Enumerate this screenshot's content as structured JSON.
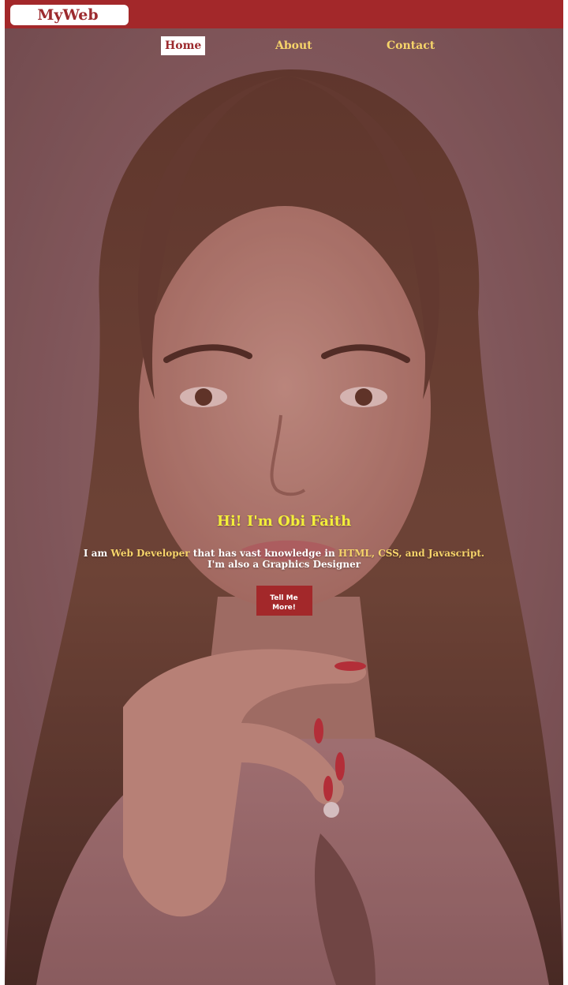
{
  "brand": {
    "name": "MyWeb"
  },
  "nav": {
    "items": [
      {
        "label": "Home",
        "active": true
      },
      {
        "label": "About",
        "active": false
      },
      {
        "label": "Contact",
        "active": false
      }
    ]
  },
  "hero": {
    "greeting": "Hi! I'm Obi Faith",
    "intro_prefix": "I am ",
    "role": "Web Developer",
    "intro_middle": " that has vast knowledge in ",
    "skills": "HTML, CSS, and Javascript.",
    "intro_line2": "I'm also a Graphics Designer",
    "cta_label": "Tell Me More!",
    "background": "portrait-photo"
  },
  "colors": {
    "brand_red": "#a3282a",
    "accent_yellow": "#f6d46a",
    "greeting_yellow": "#f3ee3a",
    "white": "#ffffff"
  }
}
